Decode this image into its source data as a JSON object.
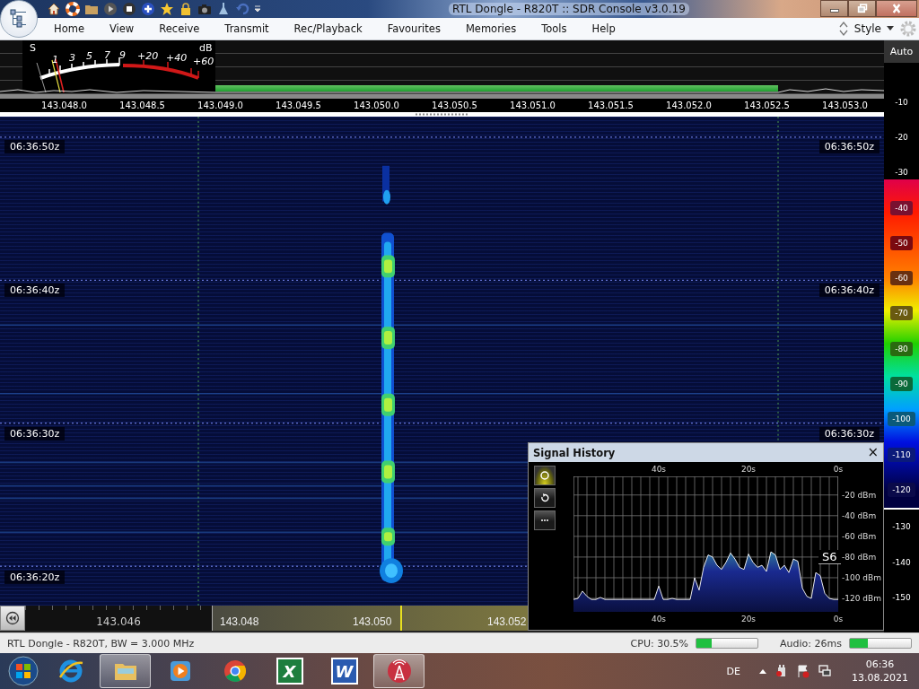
{
  "window": {
    "title": "RTL Dongle - R820T :: SDR Console v3.0.19"
  },
  "menu": [
    "Home",
    "View",
    "Receive",
    "Transmit",
    "Rec/Playback",
    "Favourites",
    "Memories",
    "Tools",
    "Help"
  ],
  "style_menu": {
    "label": "Style"
  },
  "s_meter": {
    "labels": [
      "S",
      "dB",
      "1",
      "3",
      "5",
      "7",
      "9",
      "+20",
      "+40",
      "+60"
    ]
  },
  "frequency_axis": [
    "143.048.0",
    "143.048.5",
    "143.049.0",
    "143.049.5",
    "143.050.0",
    "143.050.5",
    "143.051.0",
    "143.051.5",
    "143.052.0",
    "143.052.5",
    "143.053.0"
  ],
  "waterfall": {
    "time_labels_left": [
      "06:36:50z",
      "06:36:40z",
      "06:36:30z",
      "06:36:20z"
    ],
    "time_labels_right": [
      "06:36:50z",
      "06:36:40z",
      "06:36:30z"
    ]
  },
  "tuning_bar": {
    "labels": [
      "143.046",
      "143.048",
      "143.050",
      "143.052"
    ]
  },
  "signal_history": {
    "title": "Signal History",
    "close": "×",
    "buttons": [
      {
        "kind": "circle",
        "selected": true
      },
      {
        "kind": "refresh",
        "selected": false
      },
      {
        "kind": "more",
        "selected": false
      }
    ],
    "time_ticks_bottom": [
      "40s",
      "20s",
      "0s"
    ],
    "s_reading": "S6",
    "chart_data": {
      "type": "line",
      "grid": true,
      "xlim": [
        -59,
        0
      ],
      "ylim": [
        -133,
        -2
      ],
      "xticks": [
        {
          "value": -40,
          "label": "40s"
        },
        {
          "value": -20,
          "label": "20s"
        },
        {
          "value": 0,
          "label": "0s"
        }
      ],
      "yticks": [
        {
          "value": -20,
          "label": "-20 dBm"
        },
        {
          "value": -40,
          "label": "-40 dBm"
        },
        {
          "value": -60,
          "label": "-60 dBm"
        },
        {
          "value": -80,
          "label": "-80 dBm"
        },
        {
          "value": -100,
          "label": "-100 dBm"
        },
        {
          "value": -120,
          "label": "-120 dBm"
        }
      ],
      "x": [
        -59,
        -58,
        -57,
        -56,
        -55,
        -54,
        -53,
        -52,
        -51,
        -50,
        -49,
        -48,
        -47,
        -46,
        -45,
        -44,
        -43,
        -42,
        -41,
        -40,
        -39,
        -38,
        -37,
        -36,
        -35,
        -34,
        -33,
        -32,
        -31,
        -30,
        -29,
        -28,
        -27,
        -26,
        -25,
        -24,
        -23,
        -22,
        -21,
        -20,
        -19,
        -18,
        -17,
        -16,
        -15,
        -14,
        -13,
        -12,
        -11,
        -10,
        -9,
        -8,
        -7,
        -6,
        -5,
        -4,
        -3,
        -2,
        -1,
        0
      ],
      "series": [
        {
          "color": "#ffffff",
          "values": [
            -121,
            -120,
            -113,
            -118,
            -121,
            -121,
            -119,
            -121,
            -121,
            -121,
            -121,
            -121,
            -121,
            -121,
            -121,
            -121,
            -121,
            -121,
            -121,
            -108,
            -121,
            -121,
            -120,
            -121,
            -121,
            -121,
            -121,
            -100,
            -112,
            -90,
            -78,
            -80,
            -88,
            -92,
            -85,
            -76,
            -82,
            -90,
            -92,
            -77,
            -85,
            -90,
            -88,
            -94,
            -75,
            -78,
            -92,
            -88,
            -95,
            -82,
            -84,
            -110,
            -118,
            -120,
            -95,
            -98,
            -115,
            -120,
            -121,
            -121
          ]
        }
      ]
    }
  },
  "scale": {
    "auto": "Auto",
    "levels": [
      {
        "text": "-10",
        "kind": "plain"
      },
      {
        "text": "-20",
        "kind": "plain"
      },
      {
        "text": "-30",
        "kind": "plain"
      },
      {
        "text": "-40",
        "kind": "band",
        "color": "#7a1030"
      },
      {
        "text": "-50",
        "kind": "band",
        "color": "#7a0a10"
      },
      {
        "text": "-60",
        "kind": "band",
        "color": "#6a3010"
      },
      {
        "text": "-70",
        "kind": "band",
        "color": "#6a5a10"
      },
      {
        "text": "-80",
        "kind": "band",
        "color": "#2a6a10"
      },
      {
        "text": "-90",
        "kind": "band",
        "color": "#0a6a3a"
      },
      {
        "text": "-100",
        "kind": "band",
        "color": "#0a5a7a"
      },
      {
        "text": "-110",
        "kind": "band",
        "color": "#0a1a7a"
      },
      {
        "text": "-120",
        "kind": "band",
        "color": "#0a0a4a"
      },
      {
        "text": "-130",
        "kind": "plain"
      },
      {
        "text": "-140",
        "kind": "plain"
      },
      {
        "text": "-150",
        "kind": "plain"
      }
    ]
  },
  "status_bar": {
    "text": "RTL Dongle - R820T, BW = 3.000 MHz",
    "meters": [
      {
        "label": "CPU: 30.5%",
        "level": 0.25
      },
      {
        "label": "Audio: 26ms",
        "level": 0.3
      }
    ]
  },
  "taskbar": {
    "apps": [
      {
        "kind": "start"
      },
      {
        "kind": "browser",
        "selected": false
      },
      {
        "kind": "folder",
        "selected": true
      },
      {
        "kind": "media",
        "selected": false
      },
      {
        "kind": "chrome",
        "selected": false
      },
      {
        "kind": "sheet",
        "glyph": "X",
        "selected": false
      },
      {
        "kind": "doc",
        "glyph": "W",
        "selected": false
      },
      {
        "kind": "radio",
        "selected": true
      }
    ],
    "language": "DE",
    "time": "06:36",
    "date": "13.08.2021"
  }
}
